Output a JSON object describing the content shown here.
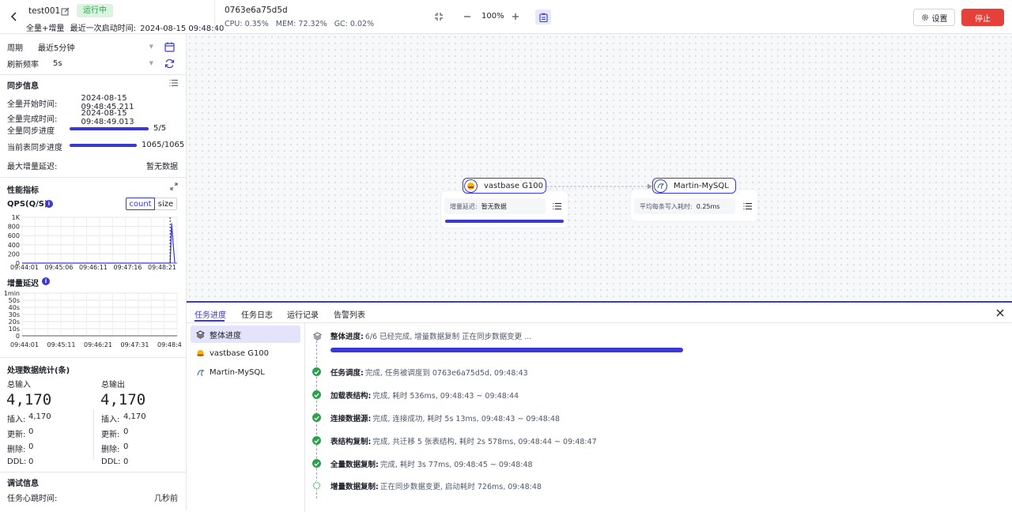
{
  "header": {
    "task_name": "test001",
    "status_badge": "运行中",
    "subtitle_type": "全量+增量",
    "last_start_label": "最近一次启动时间:",
    "last_start_time": "2024-08-15 09:48:40",
    "agent_id": "0763e6a75d5d",
    "cpu_label": "CPU:",
    "cpu_value": "0.35%",
    "mem_label": "MEM:",
    "mem_value": "72.32%",
    "gc_label": "GC:",
    "gc_value": "0.02%",
    "zoom": "100%",
    "settings_label": "设置",
    "stop_label": "停止",
    "colors": {
      "accent": "#3b38d4",
      "stop": "#e5403a",
      "badge_bg": "#d9f5e0",
      "badge_text": "#2ba14a"
    }
  },
  "left": {
    "period_label": "周期",
    "period_value": "最近5分钟",
    "refresh_label": "刷新频率",
    "refresh_value": "5s",
    "sync": {
      "title": "同步信息",
      "full_start_label": "全量开始时间:",
      "full_start_value": "2024-08-15 09:48:45.211",
      "full_end_label": "全量完成时间:",
      "full_end_value": "2024-08-15 09:48:49.013",
      "full_progress_label": "全量同步进度",
      "full_progress_value": "5/5",
      "full_progress_fraction": 1.0,
      "table_progress_label": "当前表同步进度",
      "table_progress_value": "1065/1065",
      "table_progress_fraction": 1.0,
      "max_delay_label": "最大增量延迟:",
      "max_delay_value": "暂无数据"
    },
    "perf": {
      "title": "性能指标",
      "qps_label": "QPS(Q/S)",
      "toggle_count": "count",
      "toggle_size": "size",
      "delay_label": "增量延迟"
    },
    "stats": {
      "title": "处理数据统计(条)",
      "input_label": "总输入",
      "input_total": "4,170",
      "output_label": "总输出",
      "output_total": "4,170",
      "insert_label": "插入:",
      "update_label": "更新:",
      "delete_label": "删除:",
      "ddl_label": "DDL:",
      "input_insert": "4,170",
      "input_update": "0",
      "input_delete": "0",
      "input_ddl": "0",
      "output_insert": "4,170",
      "output_update": "0",
      "output_delete": "0",
      "output_ddl": "0"
    },
    "debug": {
      "title": "调试信息",
      "heartbeat_label": "任务心跳时间:",
      "heartbeat_value": "几秒前"
    }
  },
  "chart_data": [
    {
      "type": "line",
      "title": "QPS(Q/S)",
      "yticks": [
        "1K",
        "800",
        "600",
        "400",
        "200",
        "0"
      ],
      "ylim": [
        0,
        1000
      ],
      "xticks": [
        "09:44:01",
        "09:45:06",
        "09:46:11",
        "09:47:16",
        "09:48:21"
      ],
      "series": [
        {
          "values": [
            [
              0,
              0
            ],
            [
              0.955,
              0
            ],
            [
              0.965,
              870
            ],
            [
              0.975,
              400
            ],
            [
              0.985,
              0
            ]
          ]
        }
      ],
      "grid": true
    },
    {
      "type": "line",
      "title": "增量延迟",
      "yticks": [
        "1min",
        "50s",
        "40s",
        "30s",
        "20s",
        "10s",
        "0"
      ],
      "ylim": [
        0,
        60
      ],
      "xticks": [
        "09:44:01",
        "09:45:11",
        "09:46:21",
        "09:47:31",
        "09:48:4"
      ],
      "series": [
        {
          "values": []
        }
      ],
      "grid": true
    }
  ],
  "canvas": {
    "source_node": "vastbase G100",
    "source_metric_label": "增量延迟:",
    "source_metric_value": "暂无数据",
    "source_progress": 1.0,
    "target_node": "Martin-MySQL",
    "target_metric_label": "平均每条写入耗时:",
    "target_metric_value": "0.25ms"
  },
  "bottom": {
    "tabs": [
      "任务进度",
      "任务日志",
      "运行记录",
      "告警列表"
    ],
    "sidebar": [
      "整体进度",
      "vastbase G100",
      "Martin-MySQL"
    ],
    "overall_label": "整体进度:",
    "overall_text": "6/6 已经完成, 增量数据复制 正在同步数据变更 ...",
    "overall_fraction": 1.0,
    "steps": [
      {
        "name": "任务调度:",
        "text": "完成, 任务被调度到 0763e6a75d5d, 09:48:43",
        "state": "done"
      },
      {
        "name": "加载表结构:",
        "text": "完成, 耗时 536ms, 09:48:43 ~ 09:48:44",
        "state": "done"
      },
      {
        "name": "连接数据源:",
        "text": "完成, 连接成功, 耗时 5s 13ms, 09:48:43 ~ 09:48:48",
        "state": "done"
      },
      {
        "name": "表结构复制:",
        "text": "完成, 共迁移 5 张表结构, 耗时 2s 578ms, 09:48:44 ~ 09:48:47",
        "state": "done"
      },
      {
        "name": "全量数据复制:",
        "text": "完成, 耗时 3s 77ms, 09:48:45 ~ 09:48:48",
        "state": "done"
      },
      {
        "name": "增量数据复制:",
        "text": "正在同步数据变更, 启动耗时 726ms, 09:48:48",
        "state": "running"
      }
    ]
  }
}
